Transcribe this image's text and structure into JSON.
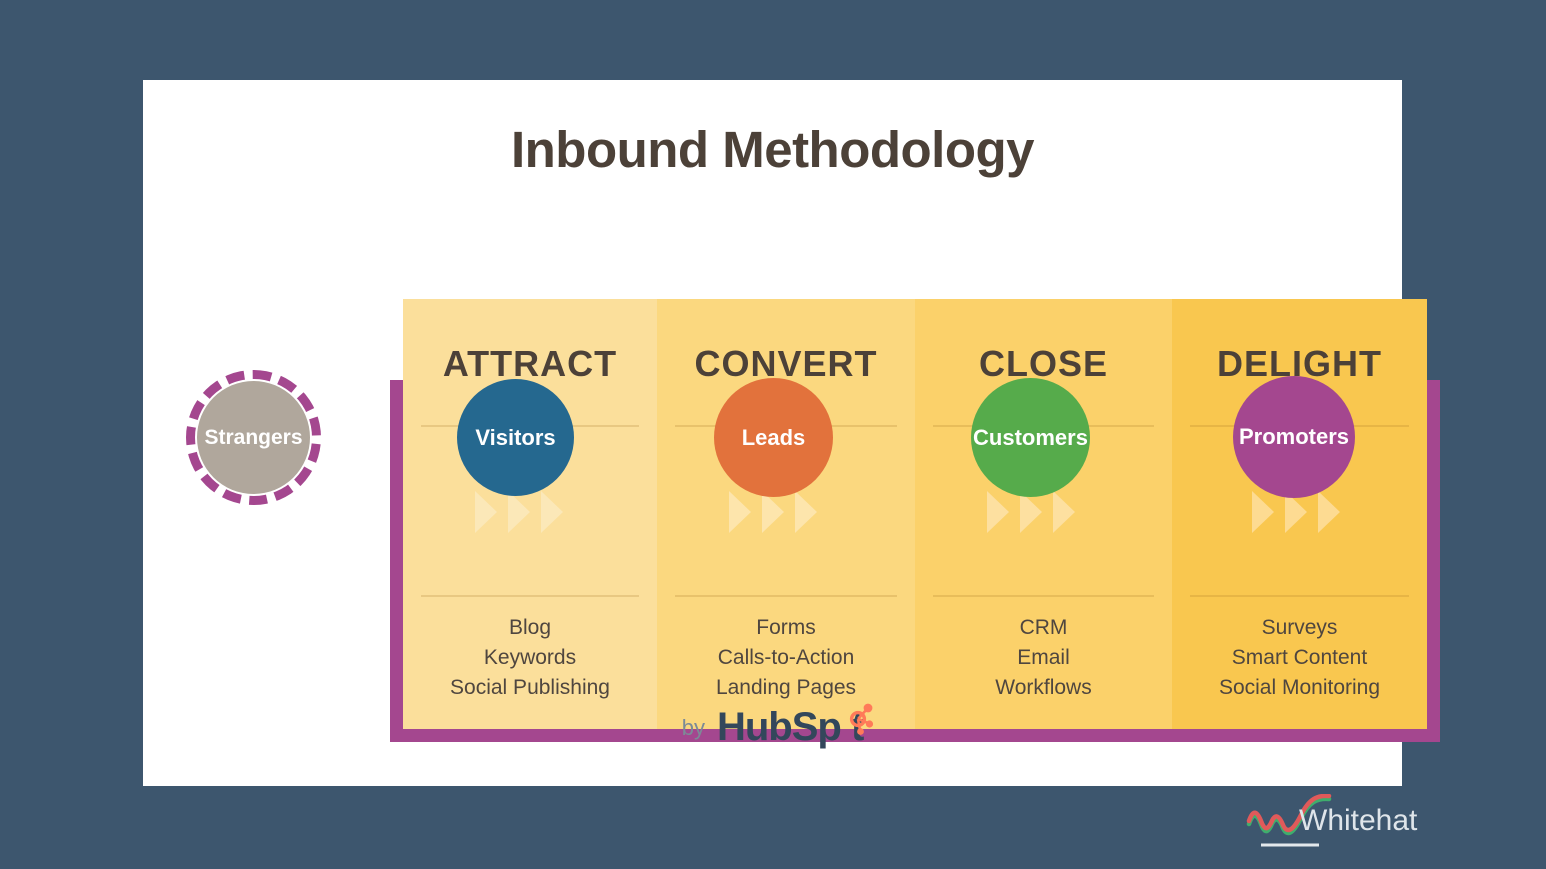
{
  "background_color": "#3d566e",
  "card": {
    "background": "#ffffff"
  },
  "title": "Inbound Methodology",
  "title_color": "#4c4138",
  "frame": {
    "accent_color": "#a4478f"
  },
  "stages": [
    {
      "name": "ATTRACT",
      "fill": "#fbdf9b",
      "tactics": [
        "Blog",
        "Keywords",
        "Social Publishing"
      ]
    },
    {
      "name": "CONVERT",
      "fill": "#fbd87f",
      "tactics": [
        "Forms",
        "Calls-to-Action",
        "Landing Pages"
      ]
    },
    {
      "name": "CLOSE",
      "fill": "#fbd16a",
      "tactics": [
        "CRM",
        "Email",
        "Workflows"
      ]
    },
    {
      "name": "DELIGHT",
      "fill": "#f9c74f",
      "tactics": [
        "Surveys",
        "Smart Content",
        "Social Monitoring"
      ]
    }
  ],
  "personas": [
    {
      "label": "Strangers",
      "color": "#b0a79c",
      "ring": "dashed",
      "ring_color": "#a4478f"
    },
    {
      "label": "Visitors",
      "color": "#25688f",
      "ring": "none"
    },
    {
      "label": "Leads",
      "color": "#e2723c",
      "ring": "none"
    },
    {
      "label": "Customers",
      "color": "#56ab4b",
      "ring": "none"
    },
    {
      "label": "Promoters",
      "color": "#a4478f",
      "ring": "none"
    }
  ],
  "attribution": {
    "by_label": "by",
    "brand": "HubSp t",
    "brand_color": "#33475b",
    "sprocket_color": "#ff7a59"
  },
  "watermark": {
    "name": "Whitehat",
    "wave_colors": [
      "#e05a5a",
      "#3fae6d"
    ],
    "text_color": "#dfe5ea"
  }
}
